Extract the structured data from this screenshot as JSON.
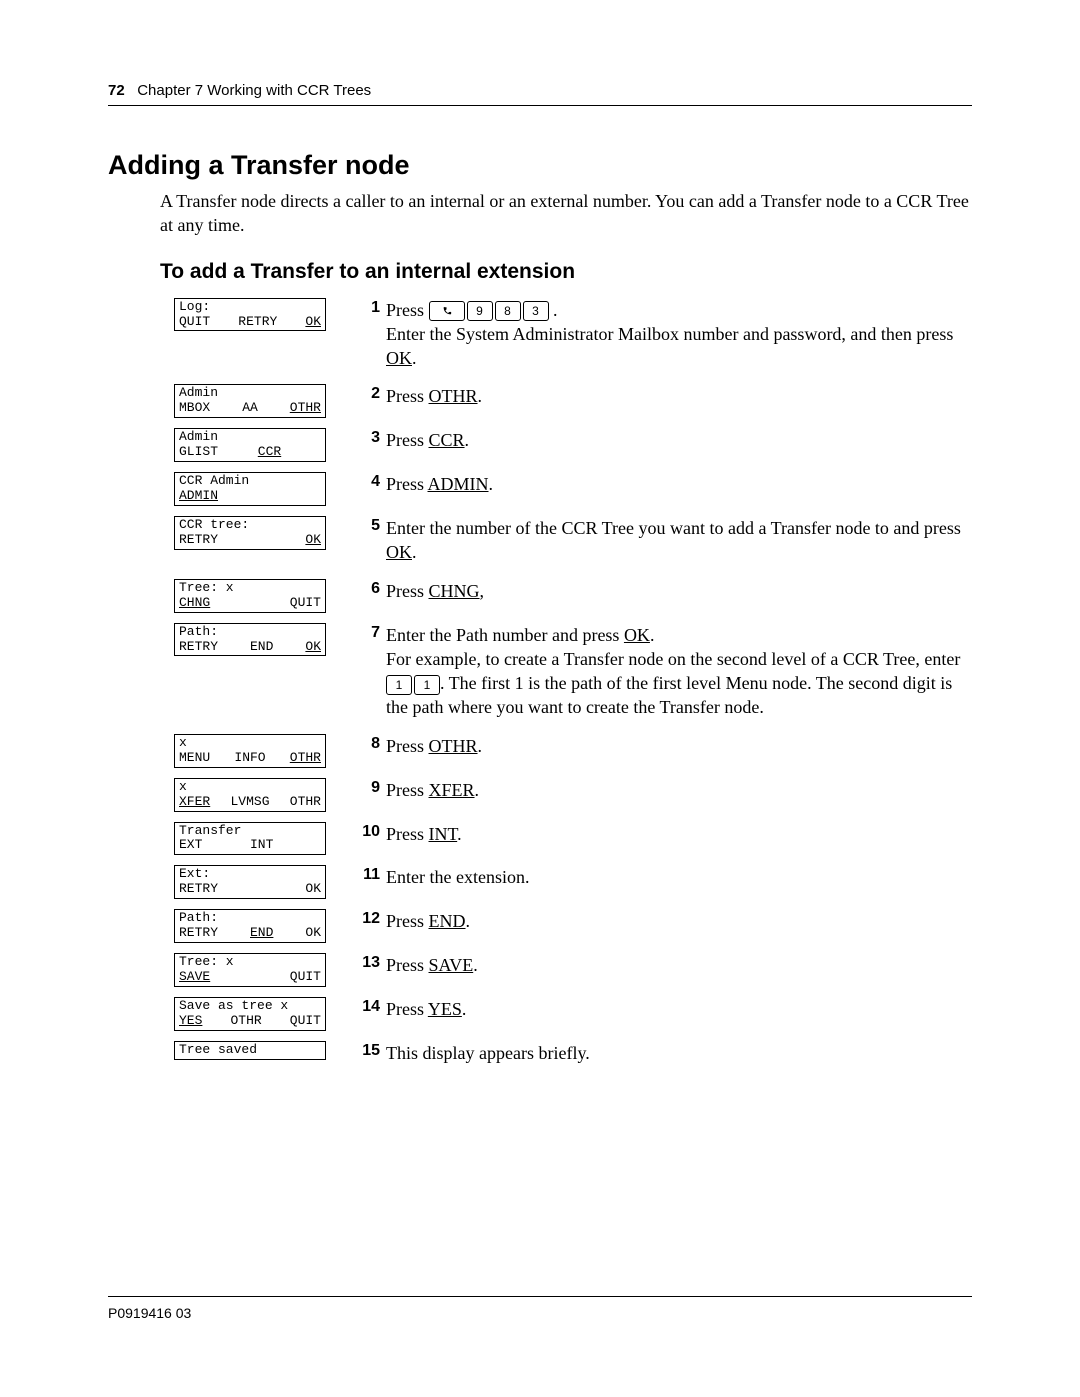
{
  "header": {
    "page_number": "72",
    "chapter": "Chapter 7  Working with CCR Trees"
  },
  "title": "Adding a Transfer node",
  "intro": "A Transfer node directs a caller to an internal or an external number. You can add a Transfer node to a CCR Tree at any time.",
  "subhead": "To add a Transfer to an internal extension",
  "feature_keys": [
    "9",
    "8",
    "3"
  ],
  "example_keys": [
    "1",
    "1"
  ],
  "labels": {
    "press": "Press",
    "press_space": "Press ",
    "enter_ext": "Enter the extension.",
    "this_display": "This display appears briefly."
  },
  "soft": {
    "OK": "OK",
    "OTHR": "OTHR",
    "CCR": "CCR",
    "ADMIN": "ADMIN",
    "CHNG": "CHNG",
    "XFER": "XFER",
    "INT": "INT",
    "END": "END",
    "SAVE": "SAVE",
    "YES": "YES"
  },
  "steps": {
    "s1a": "Enter the System Administrator Mailbox number and password, and then press ",
    "s5a": "Enter the number of the CCR Tree you want to add a Transfer node to and press ",
    "s7a": "Enter the Path number and press ",
    "s7b": "For example, to create a Transfer node on the second level of a CCR Tree, enter ",
    "s7c": ". The first 1 is the path of the first level Menu node. The second digit is the path where you want to create the Transfer node."
  },
  "lcd": {
    "d1": {
      "l1": "Log:",
      "l2": [
        "QUIT",
        "RETRY",
        "<u>OK</u>"
      ]
    },
    "d2": {
      "l1": "Admin",
      "l2": [
        "MBOX",
        "AA",
        "<u>OTHR</u>"
      ]
    },
    "d3": {
      "l1": "Admin",
      "l2": [
        "GLIST",
        "<u>CCR</u>",
        ""
      ]
    },
    "d4": {
      "l1": "CCR Admin",
      "l2": [
        "<u>ADMIN</u>",
        "",
        ""
      ]
    },
    "d5": {
      "l1": "CCR tree:",
      "l2": [
        "RETRY",
        "",
        "<u>OK</u>"
      ]
    },
    "d6": {
      "l1": "Tree: x",
      "l2": [
        "<u>CHNG</u>",
        "",
        "QUIT"
      ]
    },
    "d7": {
      "l1": "Path:",
      "l2": [
        "RETRY",
        "END",
        "<u>OK</u>"
      ]
    },
    "d8": {
      "l1": "x",
      "l2": [
        "MENU",
        "INFO",
        "<u>OTHR</u>"
      ]
    },
    "d9": {
      "l1": "x",
      "l2": [
        "<u>XFER</u>",
        "LVMSG",
        "OTHR"
      ]
    },
    "d10": {
      "l1": "Transfer",
      "l2": [
        "EXT",
        "INT",
        ""
      ]
    },
    "d11": {
      "l1": "Ext:",
      "l2": [
        "RETRY",
        "",
        "OK"
      ]
    },
    "d12": {
      "l1": "Path:",
      "l2": [
        "RETRY",
        "<u>END</u>",
        "OK"
      ]
    },
    "d13": {
      "l1": "Tree: x",
      "l2": [
        "<u>SAVE</u>",
        "",
        "QUIT"
      ]
    },
    "d14": {
      "l1": "Save as tree x",
      "l2": [
        "<u>YES</u>",
        "OTHR",
        "QUIT"
      ]
    },
    "d15": {
      "l1": "Tree saved",
      "l2": [
        "",
        "",
        ""
      ]
    }
  },
  "footer": "P0919416 03"
}
